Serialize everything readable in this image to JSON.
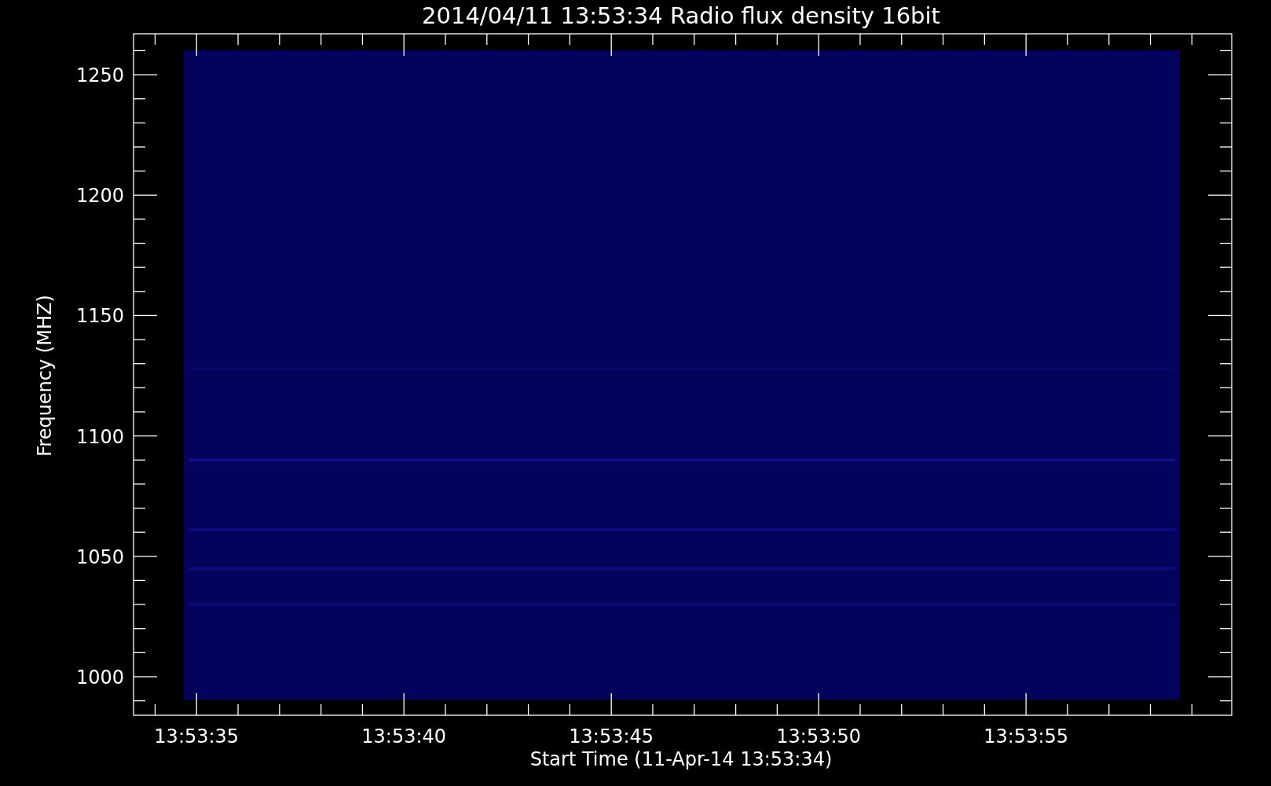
{
  "title": "2014/04/11 13:53:34 Radio flux density 16bit",
  "ylabel": "Frequency (MHZ)",
  "xlabel": "Start Time (11-Apr-14 13:53:34)",
  "yticks": [
    "1250",
    "1200",
    "1150",
    "1100",
    "1050",
    "1000"
  ],
  "xticks": [
    "13:53:35",
    "13:53:40",
    "13:53:45",
    "13:53:50",
    "13:53:55"
  ]
}
